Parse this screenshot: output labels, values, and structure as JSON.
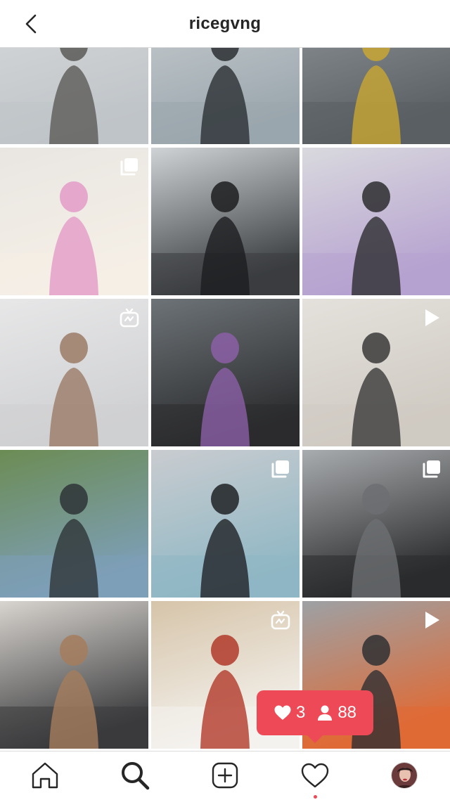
{
  "header": {
    "title": "ricegvng",
    "back_icon": "chevron-left-icon"
  },
  "grid": {
    "posts": [
      {
        "id": "post-1",
        "palette": [
          "#d7d9da",
          "#bfc4c8",
          "#5b5a58"
        ],
        "badge": null
      },
      {
        "id": "post-2",
        "palette": [
          "#c8cdd0",
          "#9aa6ad",
          "#2b2f33"
        ],
        "badge": null
      },
      {
        "id": "post-3",
        "palette": [
          "#8e9499",
          "#5a5f63",
          "#c9a632"
        ],
        "badge": null
      },
      {
        "id": "post-4",
        "palette": [
          "#e9e6e2",
          "#f5efe6",
          "#e39bc7"
        ],
        "badge": "carousel-icon"
      },
      {
        "id": "post-5",
        "palette": [
          "#cfd3d6",
          "#3a3d40",
          "#1c1d1f"
        ],
        "badge": null
      },
      {
        "id": "post-6",
        "palette": [
          "#d9d9de",
          "#b6a2d0",
          "#2d2d2f"
        ],
        "badge": null
      },
      {
        "id": "post-7",
        "palette": [
          "#e7e7e8",
          "#cfd0d2",
          "#9b7b66"
        ],
        "badge": "igtv-icon"
      },
      {
        "id": "post-8",
        "palette": [
          "#6d7377",
          "#2b2c2e",
          "#8b5fa6"
        ],
        "badge": null
      },
      {
        "id": "post-9",
        "palette": [
          "#e4e1dc",
          "#cfcac2",
          "#3a3a3a"
        ],
        "badge": "video-play-icon"
      },
      {
        "id": "post-10",
        "palette": [
          "#6c8c54",
          "#7d9fb8",
          "#2e3437"
        ],
        "badge": null
      },
      {
        "id": "post-11",
        "palette": [
          "#c9ccd0",
          "#8fb7c4",
          "#1f2225"
        ],
        "badge": "carousel-icon"
      },
      {
        "id": "post-12",
        "palette": [
          "#a9acae",
          "#2a2b2d",
          "#6d6f72"
        ],
        "badge": "carousel-icon"
      },
      {
        "id": "post-13",
        "palette": [
          "#d8d4cf",
          "#3a3b3d",
          "#a57d5d"
        ],
        "badge": null
      },
      {
        "id": "post-14",
        "palette": [
          "#d6c4a9",
          "#f4f2ee",
          "#b23a2a"
        ],
        "badge": "igtv-icon"
      },
      {
        "id": "post-15",
        "palette": [
          "#9da1a5",
          "#e06a34",
          "#2f3033"
        ],
        "badge": "video-play-icon"
      }
    ]
  },
  "activity": {
    "likes": "3",
    "followers": "88",
    "heart_icon": "heart-icon",
    "person_icon": "person-icon"
  },
  "tabbar": {
    "items": [
      {
        "name": "home",
        "icon": "home-icon"
      },
      {
        "name": "search",
        "icon": "search-icon"
      },
      {
        "name": "new-post",
        "icon": "plus-square-icon"
      },
      {
        "name": "activity",
        "icon": "heart-outline-icon"
      },
      {
        "name": "profile",
        "icon": "avatar"
      }
    ]
  },
  "colors": {
    "accent": "#ed4956",
    "text": "#262626",
    "border": "#dbdbdb"
  }
}
